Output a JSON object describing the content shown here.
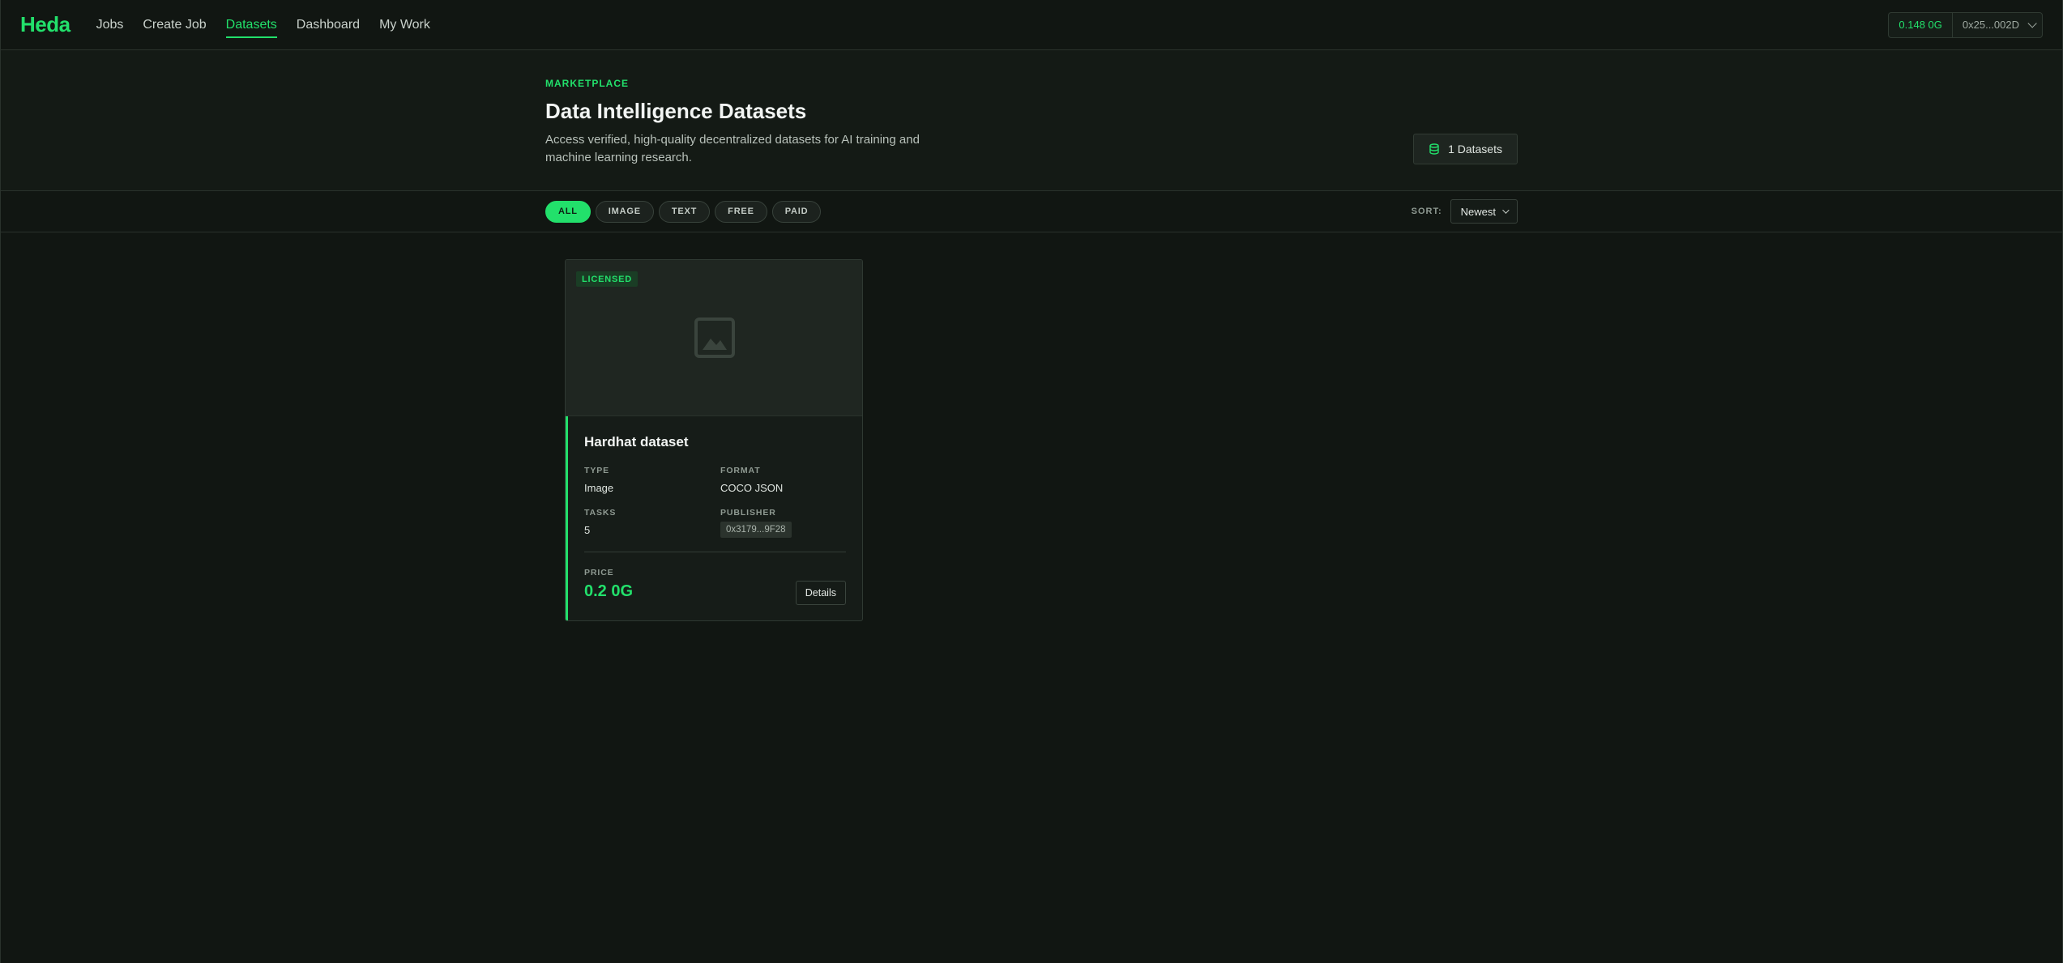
{
  "nav": {
    "brand": "Heda",
    "links": [
      "Jobs",
      "Create Job",
      "Datasets",
      "Dashboard",
      "My Work"
    ],
    "active": "Datasets"
  },
  "wallet": {
    "balance": "0.148 0G",
    "address": "0x25...002D"
  },
  "hero": {
    "eyebrow": "MARKETPLACE",
    "title": "Data Intelligence Datasets",
    "description": "Access verified, high-quality decentralized datasets for AI training and machine learning research.",
    "count_label": "1 Datasets"
  },
  "filters": {
    "chips": [
      "ALL",
      "IMAGE",
      "TEXT",
      "FREE",
      "PAID"
    ],
    "active": "ALL",
    "sort_label": "SORT:",
    "sort_value": "Newest"
  },
  "datasets": [
    {
      "badge": "LICENSED",
      "name": "Hardhat dataset",
      "type_label": "TYPE",
      "type": "Image",
      "format_label": "FORMAT",
      "format": "COCO JSON",
      "tasks_label": "TASKS",
      "tasks": "5",
      "publisher_label": "PUBLISHER",
      "publisher": "0x3179...9F28",
      "price_label": "PRICE",
      "price": "0.2 0G",
      "details_label": "Details"
    }
  ],
  "colors": {
    "accent": "#22e06b",
    "background": "#111612"
  }
}
